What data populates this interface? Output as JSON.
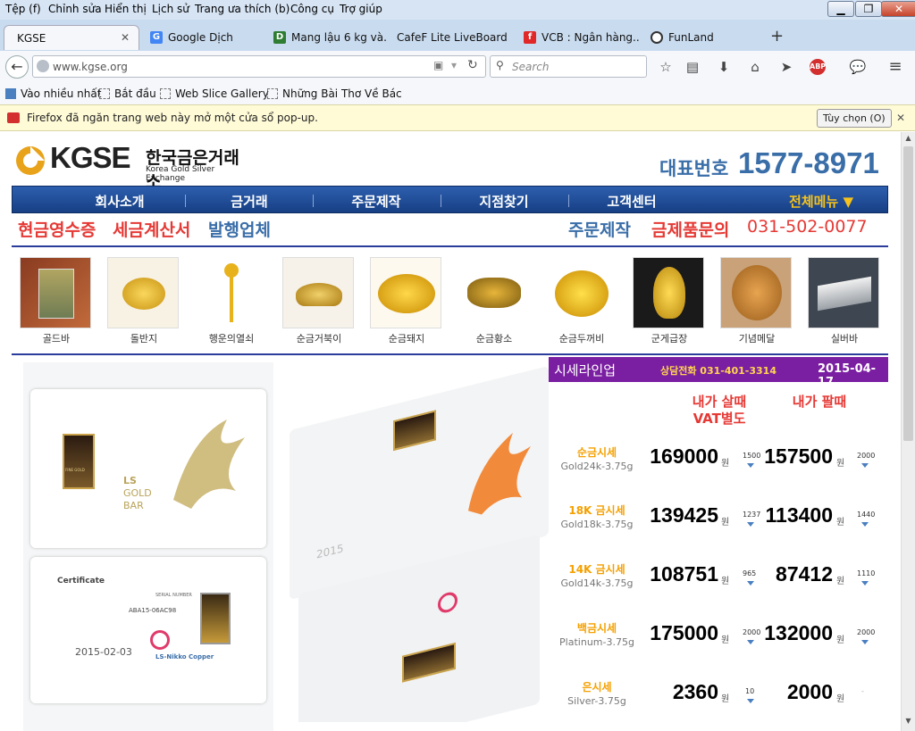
{
  "menu": [
    "Tệp (f)",
    "Chỉnh sửa",
    "Hiển thị",
    "Lịch sử",
    "Trang ưa thích (b)",
    "Công cụ",
    "Trợ giúp"
  ],
  "tabs": [
    {
      "label": "KGSE",
      "active": true
    },
    {
      "label": "Google Dịch",
      "icon": "google-translate-icon",
      "color": "#4285f4"
    },
    {
      "label": "Mang lậu 6 kg và...",
      "icon": "d-site-icon",
      "color": "#2e7d32"
    },
    {
      "label": "CafeF Lite LiveBoard"
    },
    {
      "label": "VCB : Ngân hàng...",
      "icon": "flipboard-icon",
      "color": "#e12828"
    },
    {
      "label": "FunLand",
      "icon": "steering-wheel-icon"
    }
  ],
  "address": {
    "url": "www.kgse.org",
    "search_placeholder": "Search"
  },
  "bookmarks": [
    "Vào nhiều nhất",
    "Bắt đầu",
    "Web Slice Gallery",
    "Những Bài Thơ Về Bác"
  ],
  "notification": {
    "text": "Firefox đã ngăn trang web này mở một cửa sổ pop-up.",
    "button": "Tùy chọn (O)"
  },
  "site": {
    "logo_text": "KGSE",
    "logo_kr": "한국금은거래소",
    "logo_en": "Korea Gold Silver Exchange",
    "phone_label": "대표번호",
    "phone_number": "1577-8971",
    "nav": [
      "회사소개",
      "금거래",
      "주문제작",
      "지점찾기",
      "고객센터",
      "전체메뉴 ▼"
    ],
    "subnav_left": [
      "현금영수증",
      "세금계산서",
      "발행업체"
    ],
    "subnav_right": [
      "주문제작",
      "금제품문의",
      "031-502-0077"
    ],
    "products": [
      "골드바",
      "돌반지",
      "행운의열쇠",
      "순금거북이",
      "순금돼지",
      "순금황소",
      "순금두꺼비",
      "군게급장",
      "기념메달",
      "실버바"
    ]
  },
  "card": {
    "brand_ls": "LS",
    "brand_gold": "GOLD",
    "brand_bar": "BAR",
    "certificate": "Certificate",
    "cert_date": "2015-02-03",
    "fine_gold": "FINE GOLD",
    "serial_header": "SERIAL NUMBER",
    "serial": "ABA15-06AC98",
    "nikko": "LS-Nikko Copper",
    "date_partial": "2015"
  },
  "prices": {
    "title": "시세라인업",
    "tel": "상담전화 031-401-3314",
    "date": "2015-04-17",
    "col_buy": "내가 살때",
    "col_buy2": "VAT별도",
    "col_sell": "내가 팔때",
    "unit": "원",
    "rows": [
      {
        "name": "순금시세",
        "code": "Gold24k-3.75g",
        "buy": "169000",
        "buy_diff": "1500",
        "sell": "157500",
        "sell_diff": "2000"
      },
      {
        "name": "18K 금시세",
        "code": "Gold18k-3.75g",
        "buy": "139425",
        "buy_diff": "1237",
        "sell": "113400",
        "sell_diff": "1440"
      },
      {
        "name": "14K 금시세",
        "code": "Gold14k-3.75g",
        "buy": "108751",
        "buy_diff": "965",
        "sell": "87412",
        "sell_diff": "1110"
      },
      {
        "name": "백금시세",
        "code": "Platinum-3.75g",
        "buy": "175000",
        "buy_diff": "2000",
        "sell": "132000",
        "sell_diff": "2000"
      },
      {
        "name": "은시세",
        "code": "Silver-3.75g",
        "buy": "2360",
        "buy_diff": "10",
        "sell": "2000",
        "sell_diff": "-"
      }
    ]
  }
}
